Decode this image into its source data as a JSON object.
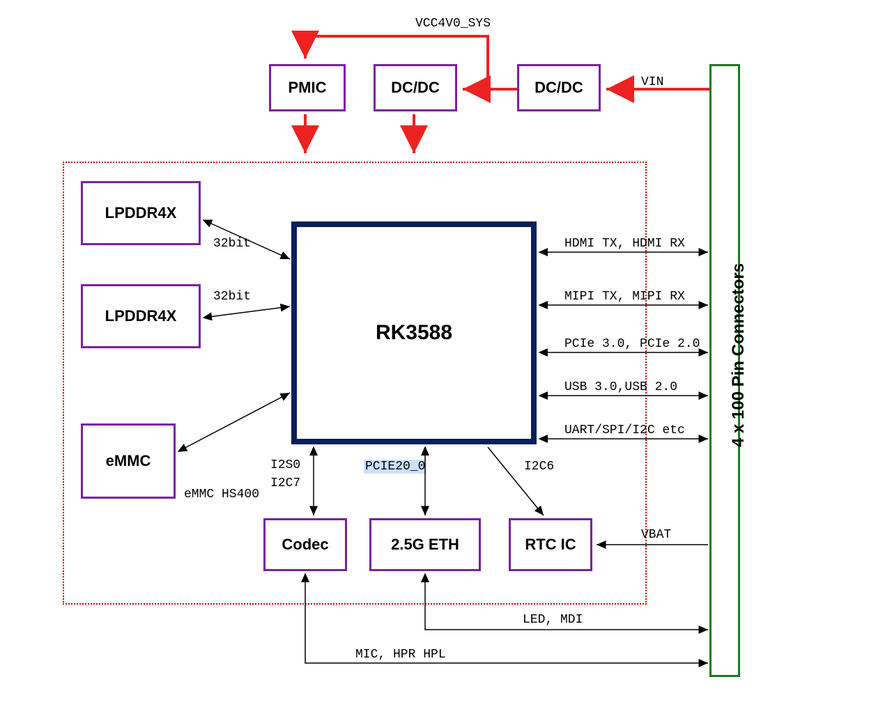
{
  "blocks": {
    "pmic": "PMIC",
    "dcdc1": "DC/DC",
    "dcdc2": "DC/DC",
    "lpddr4x_1": "LPDDR4X",
    "lpddr4x_2": "LPDDR4X",
    "emmc": "eMMC",
    "rk3588": "RK3588",
    "codec": "Codec",
    "eth": "2.5G ETH",
    "rtc": "RTC IC",
    "connector": "4 x 100 Pin Connectors"
  },
  "signals": {
    "vcc4v0": "VCC4V0_SYS",
    "vin": "VIN",
    "bus32_1": "32bit",
    "bus32_2": "32bit",
    "emmc_hs400": "eMMC HS400",
    "i2s0": "I2S0",
    "i2c7": "I2C7",
    "pcie20_0": "PCIE20_0",
    "i2c6": "I2C6",
    "hdmi": "HDMI TX, HDMI RX",
    "mipi": "MIPI TX, MIPI RX",
    "pcie": "PCIe 3.0, PCIe 2.0",
    "usb": "USB 3.0,USB 2.0",
    "uart": "UART/SPI/I2C etc",
    "vbat": "VBAT",
    "led_mdi": "LED, MDI",
    "mic_hpr": "MIC, HPR HPL"
  }
}
